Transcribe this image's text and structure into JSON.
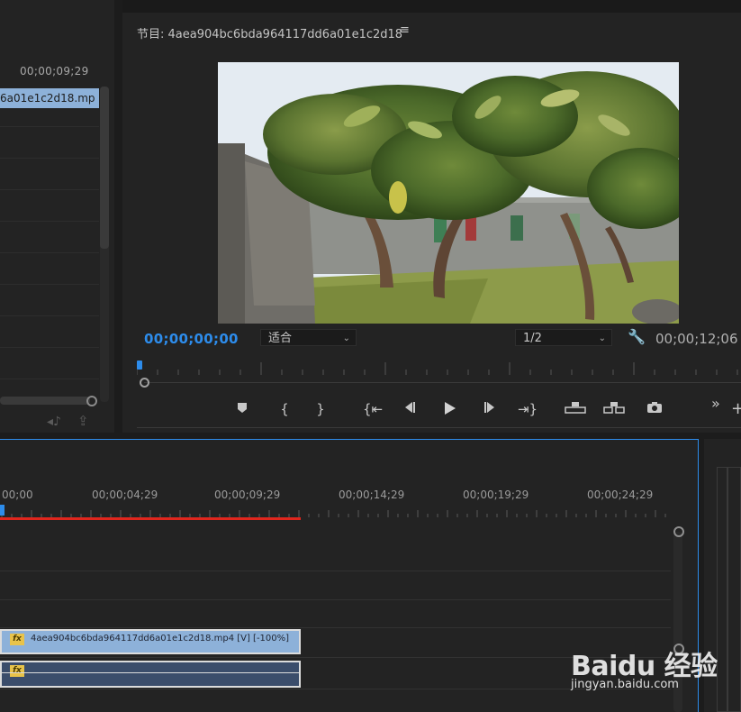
{
  "source_panel": {
    "timecode": "00;00;09;29",
    "clip_name": "6a01e1c2d18.mp"
  },
  "program_monitor": {
    "title": "节目: 4aea904bc6bda964117dd6a01e1c2d18",
    "menu_icon": "≡",
    "current_timecode": "00;00;00;00",
    "fit_label": "适合",
    "resolution_label": "1/2",
    "duration_timecode": "00;00;12;06",
    "controls": [
      {
        "name": "add-marker-icon",
        "glyph": "⬟"
      },
      {
        "name": "mark-in-icon",
        "glyph": "{"
      },
      {
        "name": "mark-out-icon",
        "glyph": "}"
      },
      {
        "name": "go-to-in-icon",
        "glyph": "{⇤"
      },
      {
        "name": "step-back-icon",
        "glyph": "◂|"
      },
      {
        "name": "play-icon",
        "glyph": "▶"
      },
      {
        "name": "step-forward-icon",
        "glyph": "|▸"
      },
      {
        "name": "go-to-out-icon",
        "glyph": "⇥}"
      },
      {
        "name": "lift-icon",
        "glyph": "⊞"
      },
      {
        "name": "extract-icon",
        "glyph": "⊟"
      },
      {
        "name": "export-frame-icon",
        "glyph": "📷"
      }
    ],
    "more_label": "»",
    "add_label": "+"
  },
  "timeline": {
    "ruler_labels": [
      "00;00",
      "00;00;04;29",
      "00;00;09;29",
      "00;00;14;29",
      "00;00;19;29",
      "00;00;24;29"
    ],
    "video_clip_label": "4aea904bc6bda964117dd6a01e1c2d18.mp4 [V] [-100%]",
    "fx_label": "fx"
  },
  "watermark": {
    "main": "Baidu 经验",
    "url": "jingyan.baidu.com"
  },
  "colors": {
    "accent_blue": "#2d8ceb",
    "clip_blue": "#8db1d9",
    "playhead_red": "#e0261d",
    "fx_yellow": "#e8c34a"
  }
}
